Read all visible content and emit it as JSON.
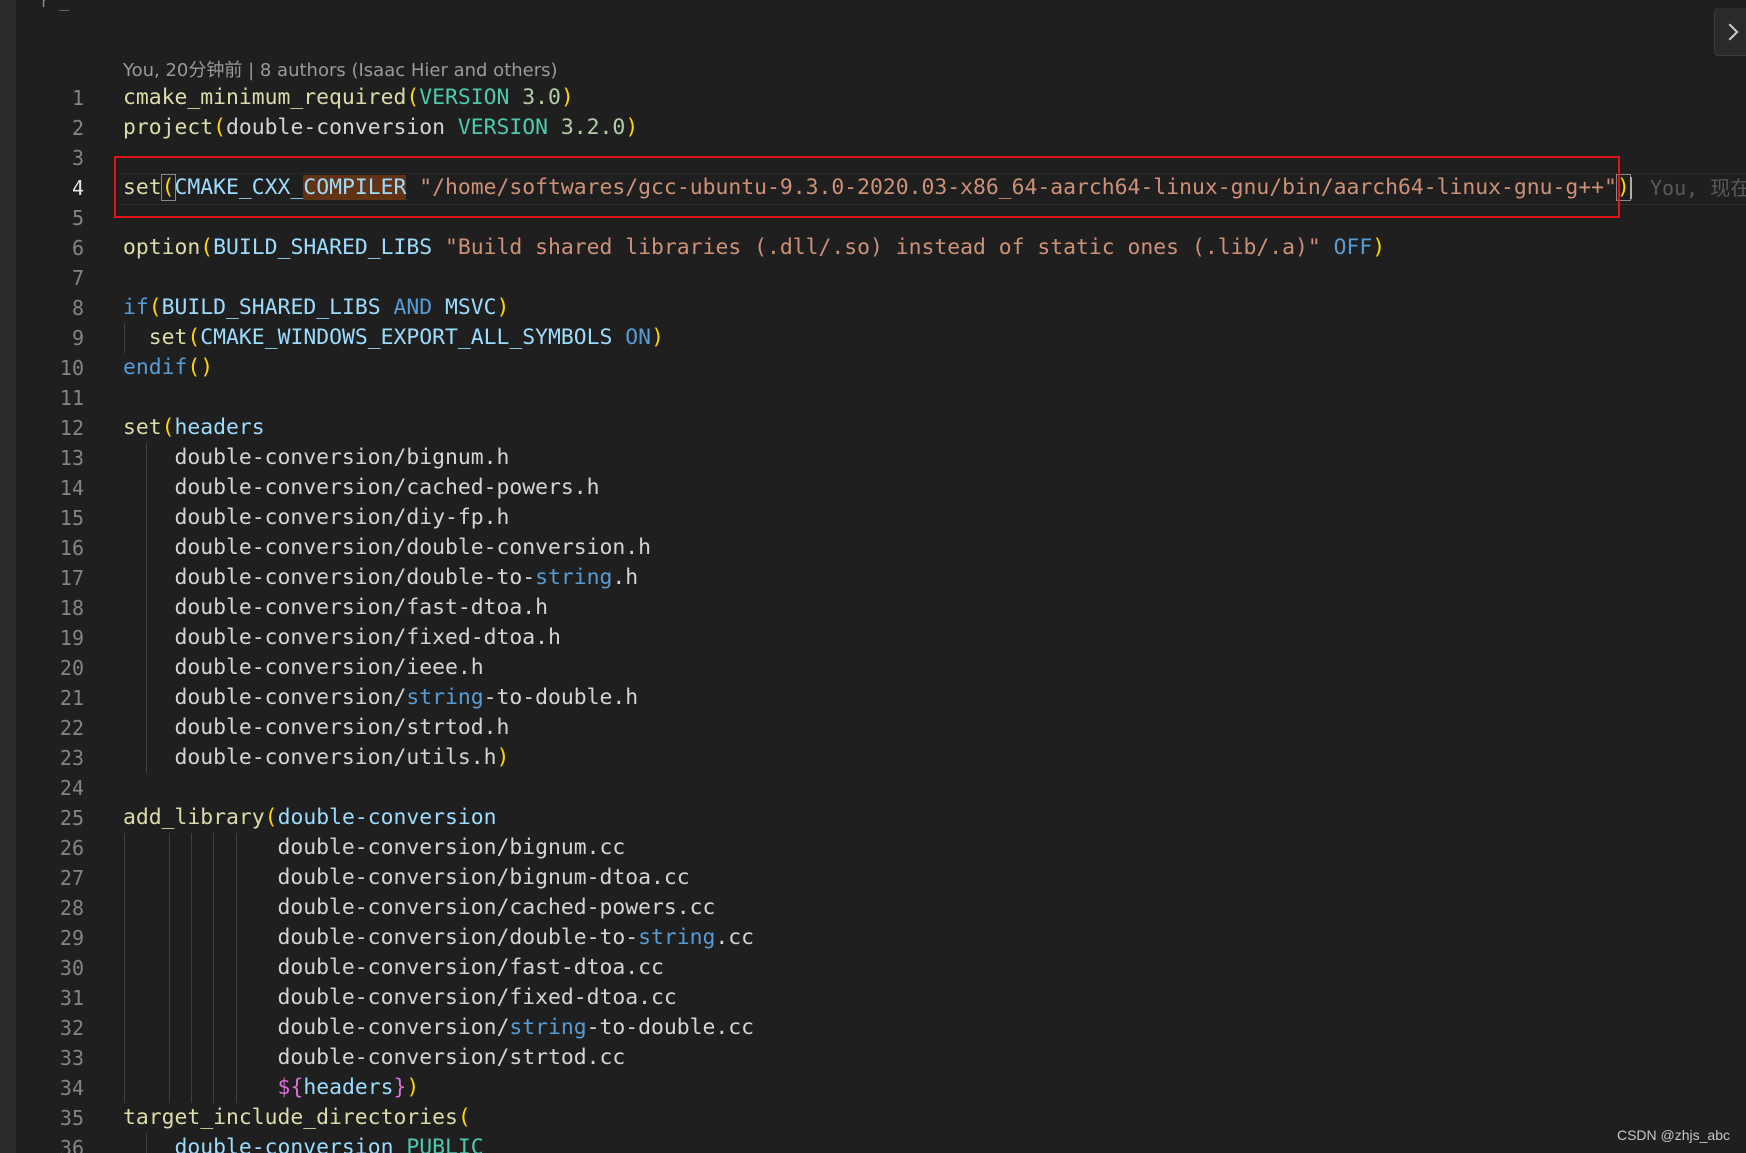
{
  "header": {
    "top_fragment": "r    _"
  },
  "codelens": {
    "text": "You, 20分钟前 | 8 authors (Isaac Hier and others)"
  },
  "inline_blame": "You, 现在",
  "watermark": "CSDN @zhjs_abc",
  "colors": {
    "background": "#1f1f1f",
    "function": "#dcdcaa",
    "variable": "#9cdcfe",
    "keyword": "#4fc1ff",
    "string": "#ce9178",
    "constant": "#4ec9b0",
    "number": "#b5cea8",
    "bracket": "#ffd700",
    "highlight_box": "#e0151a"
  },
  "active_line": 4,
  "highlighted_line": 4,
  "lines": [
    {
      "n": "1",
      "tokens": [
        [
          "cmake_minimum_required",
          "t-fn"
        ],
        [
          "(",
          "t-paren"
        ],
        [
          "VERSION",
          "t-teal"
        ],
        [
          " ",
          "t-plain"
        ],
        [
          "3.0",
          "t-num"
        ],
        [
          ")",
          "t-paren"
        ]
      ]
    },
    {
      "n": "2",
      "tokens": [
        [
          "project",
          "t-fn"
        ],
        [
          "(",
          "t-paren"
        ],
        [
          "double-conversion",
          "t-plain"
        ],
        [
          " ",
          "t-plain"
        ],
        [
          "VERSION",
          "t-teal"
        ],
        [
          " ",
          "t-plain"
        ],
        [
          "3.2.0",
          "t-num"
        ],
        [
          ")",
          "t-paren"
        ]
      ]
    },
    {
      "n": "3",
      "tokens": []
    },
    {
      "n": "4",
      "tokens": [
        [
          "set",
          "t-fn"
        ],
        [
          "(",
          "t-match"
        ],
        [
          "CMAKE_CXX_",
          "t-var"
        ],
        [
          "COMPILER",
          "t-var t-hl"
        ],
        [
          " ",
          "t-plain"
        ],
        [
          "\"/home/softwares/gcc-ubuntu-9.3.0-2020.03-x86_64-aarch64-linux-gnu/bin/aarch64-linux-gnu-g++\"",
          "t-str"
        ],
        [
          ")",
          "t-match"
        ]
      ]
    },
    {
      "n": "5",
      "tokens": []
    },
    {
      "n": "6",
      "tokens": [
        [
          "option",
          "t-fn"
        ],
        [
          "(",
          "t-paren"
        ],
        [
          "BUILD_SHARED_LIBS",
          "t-var"
        ],
        [
          " ",
          "t-plain"
        ],
        [
          "\"Build shared libraries (.dll/.so) instead of static ones (.lib/.a)\"",
          "t-str"
        ],
        [
          " ",
          "t-plain"
        ],
        [
          "OFF",
          "t-blue"
        ],
        [
          ")",
          "t-paren"
        ]
      ]
    },
    {
      "n": "7",
      "tokens": []
    },
    {
      "n": "8",
      "tokens": [
        [
          "if",
          "t-blue"
        ],
        [
          "(",
          "t-paren"
        ],
        [
          "BUILD_SHARED_LIBS",
          "t-var"
        ],
        [
          " ",
          "t-plain"
        ],
        [
          "AND",
          "t-blue"
        ],
        [
          " ",
          "t-plain"
        ],
        [
          "MSVC",
          "t-var"
        ],
        [
          ")",
          "t-paren"
        ]
      ]
    },
    {
      "n": "9",
      "tokens": [
        [
          "  ",
          "t-plain"
        ],
        [
          "set",
          "t-fn"
        ],
        [
          "(",
          "t-paren"
        ],
        [
          "CMAKE_WINDOWS_EXPORT_ALL_SYMBOLS",
          "t-var"
        ],
        [
          " ",
          "t-plain"
        ],
        [
          "ON",
          "t-blue"
        ],
        [
          ")",
          "t-paren"
        ]
      ]
    },
    {
      "n": "10",
      "tokens": [
        [
          "endif",
          "t-blue"
        ],
        [
          "()",
          "t-paren"
        ]
      ]
    },
    {
      "n": "11",
      "tokens": []
    },
    {
      "n": "12",
      "tokens": [
        [
          "set",
          "t-fn"
        ],
        [
          "(",
          "t-paren"
        ],
        [
          "headers",
          "t-var"
        ]
      ]
    },
    {
      "n": "13",
      "tokens": [
        [
          "    double-conversion/bignum.h",
          "t-plain"
        ]
      ]
    },
    {
      "n": "14",
      "tokens": [
        [
          "    double-conversion/cached-powers.h",
          "t-plain"
        ]
      ]
    },
    {
      "n": "15",
      "tokens": [
        [
          "    double-conversion/diy-fp.h",
          "t-plain"
        ]
      ]
    },
    {
      "n": "16",
      "tokens": [
        [
          "    double-conversion/double-conversion.h",
          "t-plain"
        ]
      ]
    },
    {
      "n": "17",
      "tokens": [
        [
          "    double-conversion/double-to-",
          "t-plain"
        ],
        [
          "string",
          "t-blue"
        ],
        [
          ".h",
          "t-plain"
        ]
      ]
    },
    {
      "n": "18",
      "tokens": [
        [
          "    double-conversion/fast-dtoa.h",
          "t-plain"
        ]
      ]
    },
    {
      "n": "19",
      "tokens": [
        [
          "    double-conversion/fixed-dtoa.h",
          "t-plain"
        ]
      ]
    },
    {
      "n": "20",
      "tokens": [
        [
          "    double-conversion/ieee.h",
          "t-plain"
        ]
      ]
    },
    {
      "n": "21",
      "tokens": [
        [
          "    double-conversion/",
          "t-plain"
        ],
        [
          "string",
          "t-blue"
        ],
        [
          "-to-double.h",
          "t-plain"
        ]
      ]
    },
    {
      "n": "22",
      "tokens": [
        [
          "    double-conversion/strtod.h",
          "t-plain"
        ]
      ]
    },
    {
      "n": "23",
      "tokens": [
        [
          "    double-conversion/utils.h",
          "t-plain"
        ],
        [
          ")",
          "t-paren"
        ]
      ]
    },
    {
      "n": "24",
      "tokens": []
    },
    {
      "n": "25",
      "tokens": [
        [
          "add_library",
          "t-fn"
        ],
        [
          "(",
          "t-paren"
        ],
        [
          "double-conversion",
          "t-var"
        ]
      ]
    },
    {
      "n": "26",
      "tokens": [
        [
          "            double-conversion/bignum.cc",
          "t-plain"
        ]
      ]
    },
    {
      "n": "27",
      "tokens": [
        [
          "            double-conversion/bignum-dtoa.cc",
          "t-plain"
        ]
      ]
    },
    {
      "n": "28",
      "tokens": [
        [
          "            double-conversion/cached-powers.cc",
          "t-plain"
        ]
      ]
    },
    {
      "n": "29",
      "tokens": [
        [
          "            double-conversion/double-to-",
          "t-plain"
        ],
        [
          "string",
          "t-blue"
        ],
        [
          ".cc",
          "t-plain"
        ]
      ]
    },
    {
      "n": "30",
      "tokens": [
        [
          "            double-conversion/fast-dtoa.cc",
          "t-plain"
        ]
      ]
    },
    {
      "n": "31",
      "tokens": [
        [
          "            double-conversion/fixed-dtoa.cc",
          "t-plain"
        ]
      ]
    },
    {
      "n": "32",
      "tokens": [
        [
          "            double-conversion/",
          "t-plain"
        ],
        [
          "string",
          "t-blue"
        ],
        [
          "-to-double.cc",
          "t-plain"
        ]
      ]
    },
    {
      "n": "33",
      "tokens": [
        [
          "            double-conversion/strtod.cc",
          "t-plain"
        ]
      ]
    },
    {
      "n": "34",
      "tokens": [
        [
          "            ",
          "t-plain"
        ],
        [
          "$",
          "t-paren2"
        ],
        [
          "{",
          "t-paren2"
        ],
        [
          "headers",
          "t-var"
        ],
        [
          "}",
          "t-paren2"
        ],
        [
          ")",
          "t-paren"
        ]
      ]
    },
    {
      "n": "35",
      "tokens": [
        [
          "target_include_directories",
          "t-fn"
        ],
        [
          "(",
          "t-paren"
        ]
      ]
    },
    {
      "n": "36",
      "tokens": [
        [
          "    ",
          "t-plain"
        ],
        [
          "double-conversion",
          "t-var"
        ],
        [
          " ",
          "t-plain"
        ],
        [
          "PUBLIC",
          "t-teal"
        ]
      ]
    }
  ]
}
